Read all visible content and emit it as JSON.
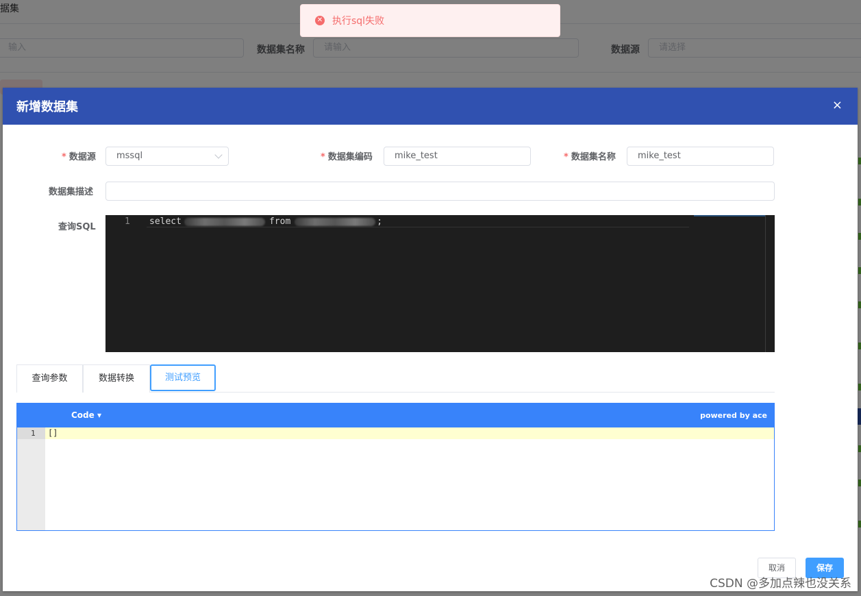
{
  "background": {
    "page_title_fragment": "据集",
    "filters": {
      "first_placeholder_fragment": "输入",
      "name_label": "数据集名称",
      "name_placeholder": "请输入",
      "source_label": "数据源",
      "source_placeholder": "请选择"
    }
  },
  "toast": {
    "icon": "error-circle-icon",
    "message": "执行sql失败",
    "color": "#f56c6c"
  },
  "dialog": {
    "title": "新增数据集",
    "close_symbol": "×",
    "header_color": "#3051b0",
    "form": {
      "datasource": {
        "label": "数据源",
        "value": "mssql",
        "required": "*"
      },
      "code": {
        "label": "数据集编码",
        "value": "mike_test",
        "required": "*"
      },
      "name": {
        "label": "数据集名称",
        "value": "mike_test",
        "required": "*"
      },
      "description": {
        "label": "数据集描述",
        "value": ""
      },
      "sql": {
        "label": "查询SQL",
        "line_number": "1",
        "keyword_select": "select",
        "keyword_from": "from",
        "terminator": ";"
      }
    },
    "tabs": [
      {
        "label": "查询参数",
        "active": false
      },
      {
        "label": "数据转换",
        "active": false
      },
      {
        "label": "测试预览",
        "active": true
      }
    ],
    "result_editor": {
      "mode_label": "Code",
      "mode_caret": "▾",
      "powered_by": "powered by ace",
      "line_number": "1",
      "content": "[]"
    },
    "footer": {
      "cancel_label": "取消",
      "save_label": "保存"
    }
  },
  "watermark": "CSDN @多加点辣也没关系"
}
